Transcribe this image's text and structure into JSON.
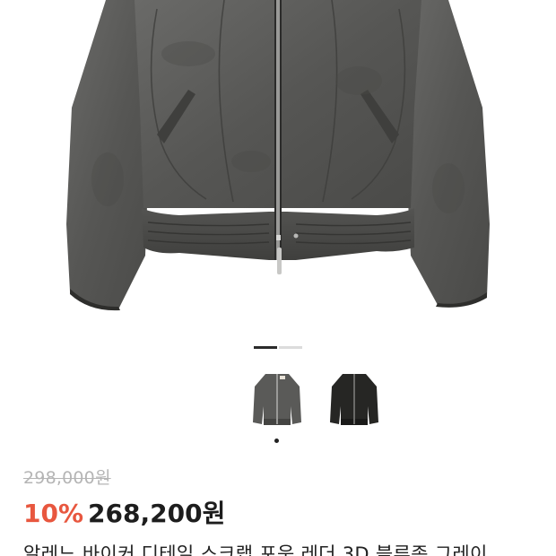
{
  "product": {
    "image_alt": "grey suede bomber jacket",
    "gallery": {
      "active_index": 1,
      "total": 2
    },
    "thumbnails": [
      {
        "name": "grey-variant",
        "color": "#5a5a5a",
        "selected": true
      },
      {
        "name": "black-variant",
        "color": "#262626",
        "selected": false
      }
    ],
    "original_price": "298,000원",
    "discount_rate": "10%",
    "sale_price": "268,200원",
    "title": "알레느 바이커 디테일 스크랩 포움 레더 3D 블루종 그레이"
  },
  "colors": {
    "discount": "#e8573f",
    "price": "#1d1d1d",
    "strike": "#b5b5b5",
    "jacket": "#5b5b59"
  }
}
